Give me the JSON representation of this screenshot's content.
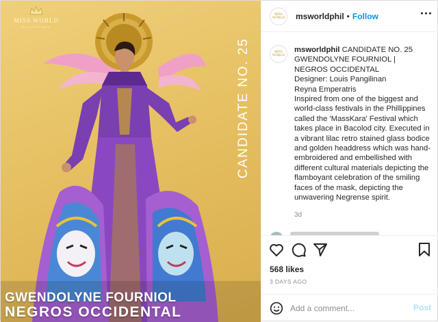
{
  "media": {
    "brand_name": "MISS WORLD",
    "brand_sub": "PHILIPPINES",
    "candidate_label": "CANDIDATE NO. 25",
    "caption_name": "GWENDOLYNE FOURNIOL",
    "caption_place": "NEGROS OCCIDENTAL"
  },
  "header": {
    "avatar_text": "MISS WORLD",
    "username": "msworldphil",
    "separator": "•",
    "follow_label": "Follow",
    "more_icon": "more-horizontal-icon"
  },
  "caption": {
    "username": "msworldphil",
    "lines": [
      "CANDIDATE NO. 25",
      "GWENDOLYNE FOURNIOL | NEGROS OCCIDENTAL",
      "Designer: Louis Pangilinan",
      "Reyna Emperatris",
      "Inspired from one of the biggest and world-class festivals in the Phillippines called the 'MassKara' Festival which takes place in Bacolod city. Executed in a vibrant lilac retro stained glass bodice and golden headdress which was hand-embroidered and embellished with different cultural materials depicting the flamboyant celebration of the smiling faces of the mask, depicting the unwavering Negrense spirit."
    ],
    "time": "3d"
  },
  "actions": {
    "icons": [
      "heart-icon",
      "comment-icon",
      "share-icon",
      "bookmark-icon"
    ]
  },
  "likes": "568 likes",
  "posted": "3 DAYS AGO",
  "composer": {
    "emoji_icon": "smiley-icon",
    "placeholder": "Add a comment...",
    "post_label": "Post"
  },
  "colors": {
    "accent": "#0095f6",
    "post_disabled": "#b2dffc",
    "gown_purple": "#7a3fb0",
    "background_gold": "#e6c063"
  }
}
